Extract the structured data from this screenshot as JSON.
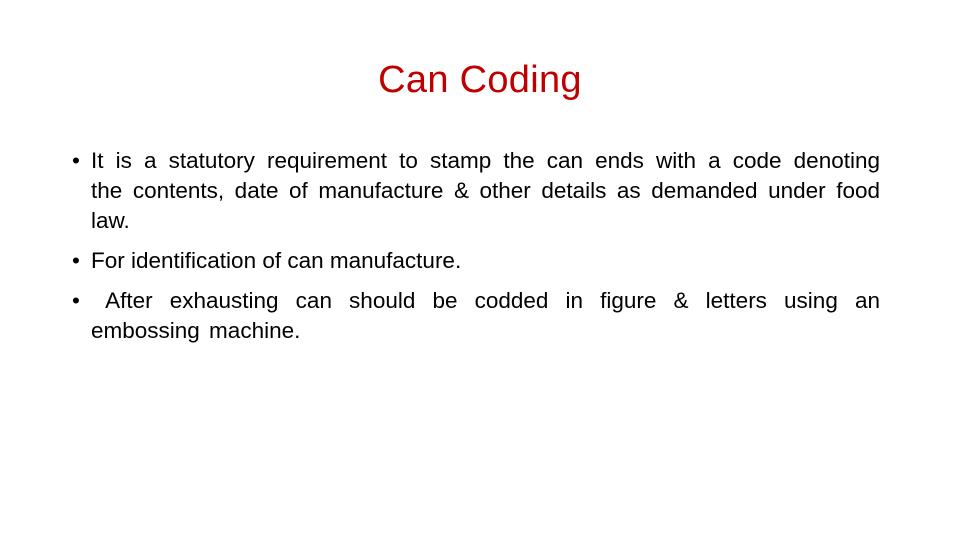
{
  "slide": {
    "title": "Can Coding",
    "title_color": "#c00000",
    "bullet_glyph": "•",
    "bullets": [
      {
        "text": "It is a statutory requirement to stamp the can ends with a code denoting the contents, date of manufacture & other details as demanded under food law."
      },
      {
        "text": "For identification of can manufacture."
      },
      {
        "text": " After exhausting can should be codded in figure & letters using an embossing machine."
      }
    ]
  }
}
